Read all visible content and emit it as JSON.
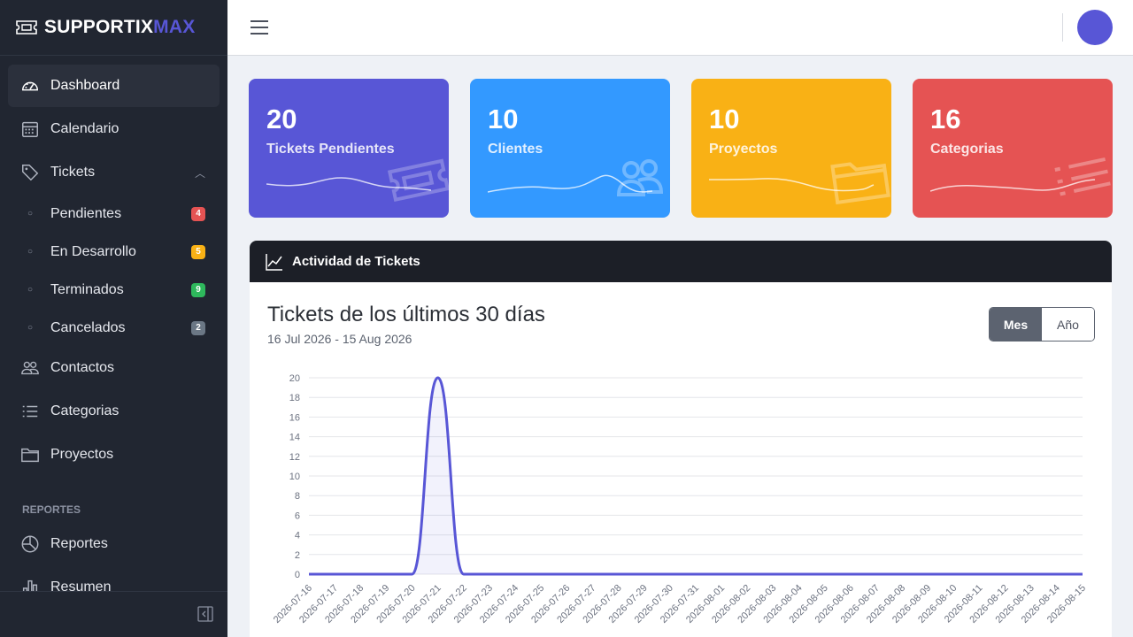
{
  "brand": {
    "part1": "SUPPORTIX",
    "part2": "MAX",
    "icon": "ticket-icon"
  },
  "sidebar": {
    "items": [
      {
        "label": "Dashboard",
        "icon": "speedometer-icon"
      },
      {
        "label": "Calendario",
        "icon": "calendar-icon"
      },
      {
        "label": "Tickets",
        "icon": "tag-icon"
      },
      {
        "label": "Contactos",
        "icon": "people-icon"
      },
      {
        "label": "Categorias",
        "icon": "list-icon"
      },
      {
        "label": "Proyectos",
        "icon": "folder-icon"
      }
    ],
    "subitems": [
      {
        "label": "Pendientes",
        "badge": "4",
        "color": "#e55353"
      },
      {
        "label": "En Desarrollo",
        "badge": "5",
        "color": "#f9b115"
      },
      {
        "label": "Terminados",
        "badge": "9",
        "color": "#2eb85c"
      },
      {
        "label": "Cancelados",
        "badge": "2",
        "color": "#6b7785"
      }
    ],
    "section_title": "REPORTES",
    "reports": [
      {
        "label": "Reportes",
        "icon": "chart-pie-icon"
      },
      {
        "label": "Resumen",
        "icon": "bar-chart-icon"
      }
    ]
  },
  "stats": [
    {
      "value": "20",
      "label": "Tickets Pendientes",
      "color": "#5856d6",
      "icon": "ticket-icon"
    },
    {
      "value": "10",
      "label": "Clientes",
      "color": "#3399ff",
      "icon": "people-icon"
    },
    {
      "value": "10",
      "label": "Proyectos",
      "color": "#f9b115",
      "icon": "folder-icon"
    },
    {
      "value": "16",
      "label": "Categorias",
      "color": "#e55353",
      "icon": "list-icon"
    }
  ],
  "activity": {
    "header": "Actividad de Tickets",
    "title": "Tickets de los últimos 30 días",
    "subtitle": "16 Jul 2026 - 15 Aug 2026",
    "toggle": [
      "Mes",
      "Año"
    ],
    "active_toggle": "Mes"
  },
  "chart_data": {
    "type": "area",
    "x": [
      "2026-07-16",
      "2026-07-17",
      "2026-07-18",
      "2026-07-19",
      "2026-07-20",
      "2026-07-21",
      "2026-07-22",
      "2026-07-23",
      "2026-07-24",
      "2026-07-25",
      "2026-07-26",
      "2026-07-27",
      "2026-07-28",
      "2026-07-29",
      "2026-07-30",
      "2026-07-31",
      "2026-08-01",
      "2026-08-02",
      "2026-08-03",
      "2026-08-04",
      "2026-08-05",
      "2026-08-06",
      "2026-08-07",
      "2026-08-08",
      "2026-08-09",
      "2026-08-10",
      "2026-08-11",
      "2026-08-12",
      "2026-08-13",
      "2026-08-14",
      "2026-08-15"
    ],
    "series": [
      {
        "values": [
          0,
          0,
          0,
          0,
          0,
          20,
          0,
          0,
          0,
          0,
          0,
          0,
          0,
          0,
          0,
          0,
          0,
          0,
          0,
          0,
          0,
          0,
          0,
          0,
          0,
          0,
          0,
          0,
          0,
          0,
          0
        ]
      }
    ],
    "ylim": [
      0,
      20
    ],
    "yticks": [
      0,
      2,
      4,
      6,
      8,
      10,
      12,
      14,
      16,
      18,
      20
    ],
    "color": "#5856d6",
    "grid": true
  }
}
